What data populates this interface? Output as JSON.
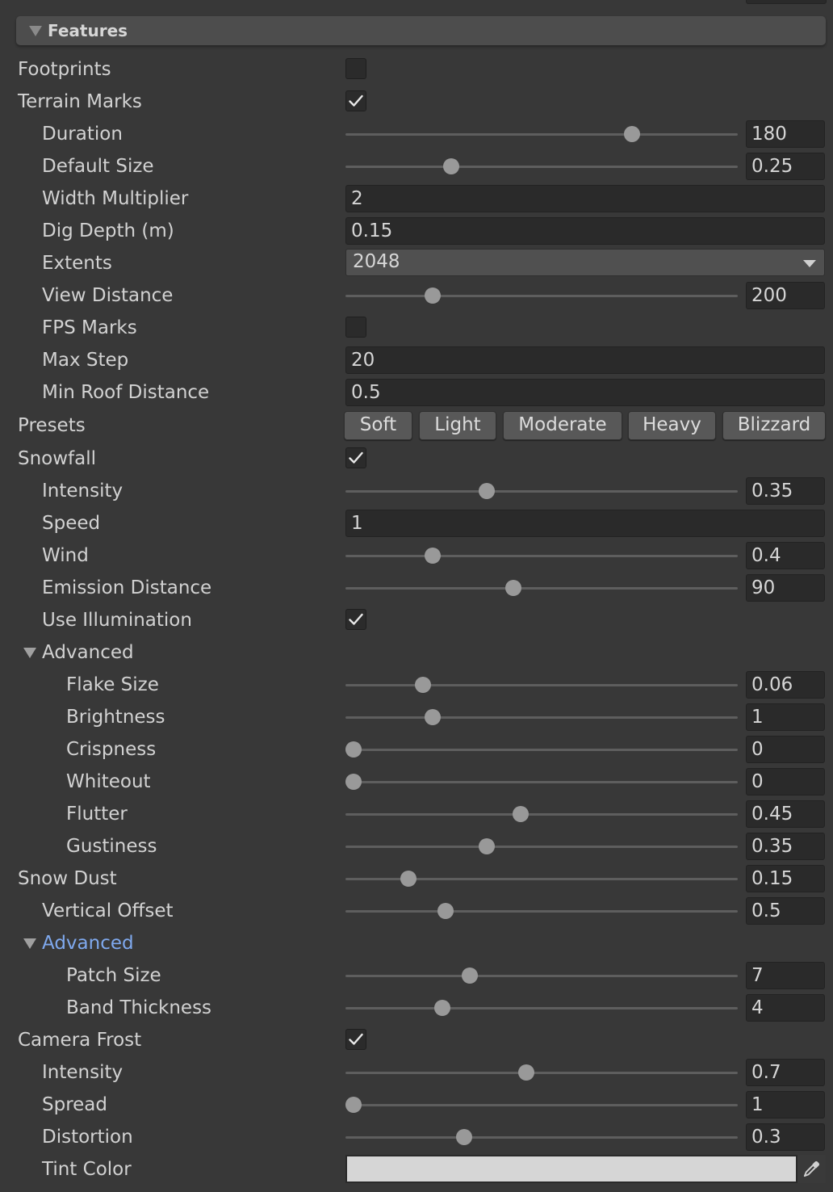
{
  "header": {
    "title": "Features"
  },
  "footprints": {
    "label": "Footprints",
    "checked": false
  },
  "terrain_marks": {
    "label": "Terrain Marks",
    "checked": true,
    "duration": {
      "label": "Duration",
      "value": "180",
      "fraction": 0.74
    },
    "default_size": {
      "label": "Default Size",
      "value": "0.25",
      "fraction": 0.26
    },
    "width_multiplier": {
      "label": "Width Multiplier",
      "value": "2"
    },
    "dig_depth": {
      "label": "Dig Depth (m)",
      "value": "0.15"
    },
    "extents": {
      "label": "Extents",
      "value": "2048"
    },
    "view_distance": {
      "label": "View Distance",
      "value": "200",
      "fraction": 0.21
    },
    "fps_marks": {
      "label": "FPS Marks",
      "checked": false
    },
    "max_step": {
      "label": "Max Step",
      "value": "20"
    },
    "min_roof_distance": {
      "label": "Min Roof Distance",
      "value": "0.5"
    }
  },
  "presets": {
    "label": "Presets",
    "buttons": [
      "Soft",
      "Light",
      "Moderate",
      "Heavy",
      "Blizzard"
    ]
  },
  "snowfall": {
    "label": "Snowfall",
    "checked": true,
    "intensity": {
      "label": "Intensity",
      "value": "0.35",
      "fraction": 0.355
    },
    "speed": {
      "label": "Speed",
      "value": "1"
    },
    "wind": {
      "label": "Wind",
      "value": "0.4",
      "fraction": 0.21
    },
    "emission_distance": {
      "label": "Emission Distance",
      "value": "90",
      "fraction": 0.425
    },
    "use_illumination": {
      "label": "Use Illumination",
      "checked": true
    },
    "advanced": {
      "label": "Advanced",
      "flake_size": {
        "label": "Flake Size",
        "value": "0.06",
        "fraction": 0.185
      },
      "brightness": {
        "label": "Brightness",
        "value": "1",
        "fraction": 0.21
      },
      "crispness": {
        "label": "Crispness",
        "value": "0",
        "fraction": 0.0
      },
      "whiteout": {
        "label": "Whiteout",
        "value": "0",
        "fraction": 0.0
      },
      "flutter": {
        "label": "Flutter",
        "value": "0.45",
        "fraction": 0.445
      },
      "gustiness": {
        "label": "Gustiness",
        "value": "0.35",
        "fraction": 0.355
      }
    }
  },
  "snow_dust": {
    "label": "Snow Dust",
    "value": "0.15",
    "fraction": 0.145,
    "vertical_offset": {
      "label": "Vertical Offset",
      "value": "0.5",
      "fraction": 0.245
    },
    "advanced": {
      "label": "Advanced",
      "patch_size": {
        "label": "Patch Size",
        "value": "7",
        "fraction": 0.31
      },
      "band_thickness": {
        "label": "Band Thickness",
        "value": "4",
        "fraction": 0.235
      }
    }
  },
  "camera_frost": {
    "label": "Camera Frost",
    "checked": true,
    "intensity": {
      "label": "Intensity",
      "value": "0.7",
      "fraction": 0.46
    },
    "spread": {
      "label": "Spread",
      "value": "1",
      "fraction": 0.0
    },
    "distortion": {
      "label": "Distortion",
      "value": "0.3",
      "fraction": 0.295
    },
    "tint_color": {
      "label": "Tint Color",
      "color": "#d6d6d6"
    }
  }
}
